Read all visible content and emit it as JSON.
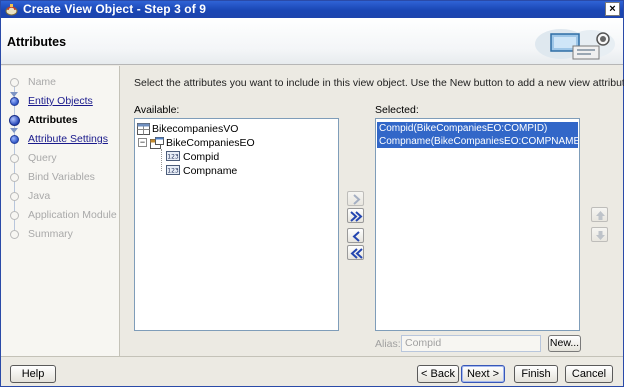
{
  "window": {
    "title": "Create View Object - Step 3 of 9",
    "close_glyph": "×"
  },
  "header": {
    "page_title": "Attributes"
  },
  "train": {
    "steps": [
      {
        "label": "Name",
        "state": "done-disabled"
      },
      {
        "label": "Entity Objects",
        "state": "link"
      },
      {
        "label": "Attributes",
        "state": "current"
      },
      {
        "label": "Attribute Settings",
        "state": "link"
      },
      {
        "label": "Query",
        "state": "disabled"
      },
      {
        "label": "Bind Variables",
        "state": "disabled"
      },
      {
        "label": "Java",
        "state": "disabled"
      },
      {
        "label": "Application Module",
        "state": "disabled"
      },
      {
        "label": "Summary",
        "state": "disabled"
      }
    ]
  },
  "main": {
    "instructions": "Select the attributes you want to include in this view object.  Use the New button to add a new view attribute.",
    "available_label": "Available:",
    "selected_label": "Selected:",
    "available_tree": {
      "root": "BikecompaniesVO",
      "entity": "BikeCompaniesEO",
      "entity_toggle": "−",
      "attributes": [
        "Compid",
        "Compname"
      ]
    },
    "selected_items": [
      "Compid(BikeCompaniesEO:COMPID)",
      "Compname(BikeCompaniesEO:COMPNAME)"
    ],
    "alias_label": "Alias:",
    "alias_value": "Compid",
    "new_button": "New..."
  },
  "footer": {
    "help": "Help",
    "back": "< Back",
    "next": "Next >",
    "finish": "Finish",
    "cancel": "Cancel"
  },
  "icons": {
    "app": "jdeveloper-icon",
    "header_deco": "view-object-graphic",
    "move_right": "move-right-icon",
    "move_all_right": "move-all-right-icon",
    "move_left": "move-left-icon",
    "move_all_left": "move-all-left-icon",
    "move_up": "move-up-icon",
    "move_down": "move-down-icon"
  },
  "colors": {
    "title_bar": "#1a46b4",
    "selection": "#3267c8",
    "link": "#1a1a8c",
    "disabled_text": "#a9a9a9"
  }
}
